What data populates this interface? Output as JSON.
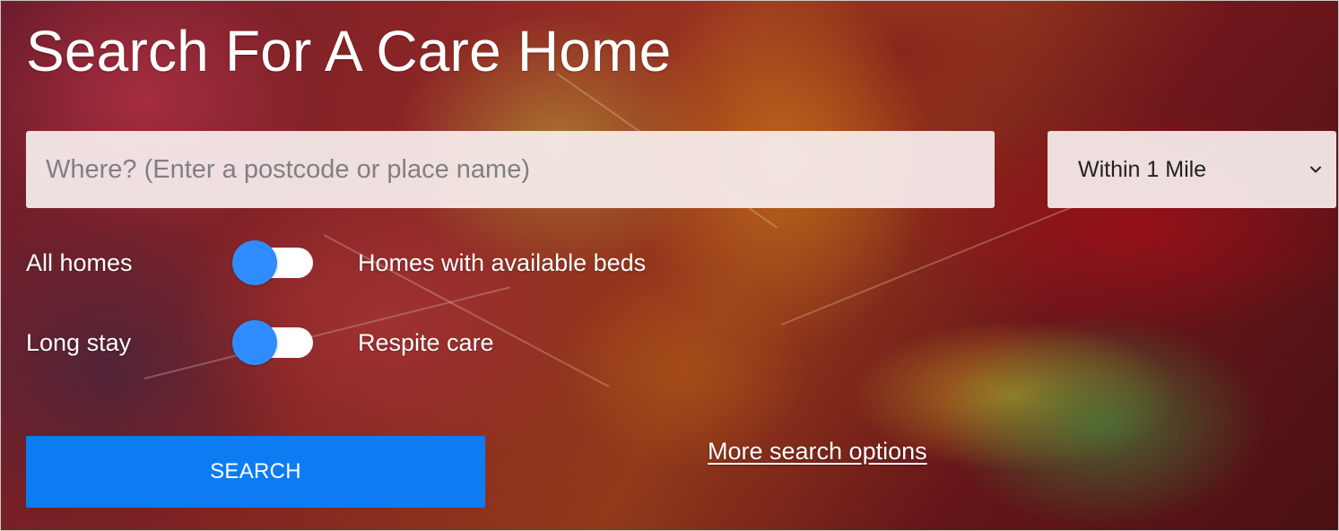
{
  "header": {
    "title": "Search For A Care Home"
  },
  "search": {
    "placeholder": "Where? (Enter a postcode or place name)",
    "value": ""
  },
  "distance": {
    "selected": "Within 1 Mile",
    "icon": "chevron-down-icon"
  },
  "filters": {
    "availability": {
      "left_label": "All homes",
      "right_label": "Homes with available beds",
      "state": "off"
    },
    "stay_type": {
      "left_label": "Long stay",
      "right_label": "Respite care",
      "state": "off"
    }
  },
  "actions": {
    "search_label": "SEARCH",
    "more_options_label": "More search options"
  },
  "colors": {
    "accent": "#0d7cf2",
    "toggle_knob": "#2f8cff",
    "input_background": "#f6eeee"
  }
}
